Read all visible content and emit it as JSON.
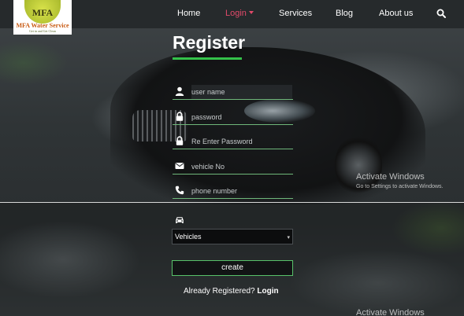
{
  "logo": {
    "initials": "MFA",
    "name": "MFA Water Service",
    "tagline": "Get in and Get Clean"
  },
  "nav": {
    "items": [
      {
        "label": "Home"
      },
      {
        "label": "Login"
      },
      {
        "label": "Services"
      },
      {
        "label": "Blog"
      },
      {
        "label": "About us"
      }
    ],
    "search_icon": "search-icon",
    "active_color": "#e24a6a"
  },
  "form": {
    "title": "Register",
    "fields": [
      {
        "icon": "user-icon",
        "placeholder": "user name"
      },
      {
        "icon": "lock-icon",
        "placeholder": "password"
      },
      {
        "icon": "lock-icon",
        "placeholder": "Re Enter Password"
      },
      {
        "icon": "envelope-icon",
        "placeholder": "vehicle No"
      },
      {
        "icon": "phone-icon",
        "placeholder": "phone number"
      }
    ],
    "vehicle_icon": "car-icon",
    "select_value": "Vehicles",
    "submit_label": "create",
    "already_text": "Already Registered?",
    "login_link": "Login",
    "accent_color": "#34c24a"
  },
  "watermark": {
    "title": "Activate Windows",
    "subtitle": "Go to Settings to activate Windows.",
    "title_repeat": "Activate Windows"
  }
}
